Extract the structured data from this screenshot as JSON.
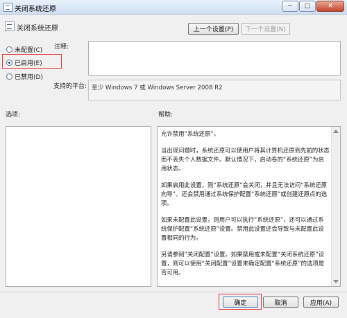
{
  "window": {
    "title": "关闭系统还原",
    "buttons": {
      "minimize": "─",
      "maximize": "□",
      "close": "✕"
    }
  },
  "header": {
    "title": "关闭系统还原",
    "prev_setting": "上一个设置(P)",
    "next_setting": "下一个设置(N)"
  },
  "radio_options": [
    {
      "label": "未配置(C)",
      "checked": false
    },
    {
      "label": "已启用(E)",
      "checked": true
    },
    {
      "label": "已禁用(D)",
      "checked": false
    }
  ],
  "comment_label": "注释:",
  "comment_value": "",
  "supported_label": "支持的平台:",
  "supported_value": "至少 Windows 7 或 Windows Server 2008 R2",
  "options_label": "选项:",
  "help_label": "帮助:",
  "help_paragraphs": [
    "允许禁用“系统还原”。",
    "当出现问题时，系统还原可以使用户将其计算机还原到先前的状态而不丢失个人数据文件。默认情况下，启动卷的“系统还原”为启用状态。",
    "如果启用此设置，则“系统还原”会关闭，并且无法访问“系统还原向导”。还会禁用通过系统保护配置“系统还原”或创建还原点的选项。",
    "如果未配置此设置，则用户可以执行“系统还原”，还可以通过系统保护配置“系统还原”设置。禁用此设置还会导致与未配置此设置相同的行为。",
    "另请参阅“关闭配置”设置。如果禁用或未配置“关闭系统还原”设置，则可以使用“关闭配置”设置来确定配置“系统还原”的选项是否可用。"
  ],
  "footer": {
    "ok": "确定",
    "cancel": "取消",
    "apply": "应用(A)"
  },
  "colors": {
    "highlight": "#e23a3a"
  }
}
